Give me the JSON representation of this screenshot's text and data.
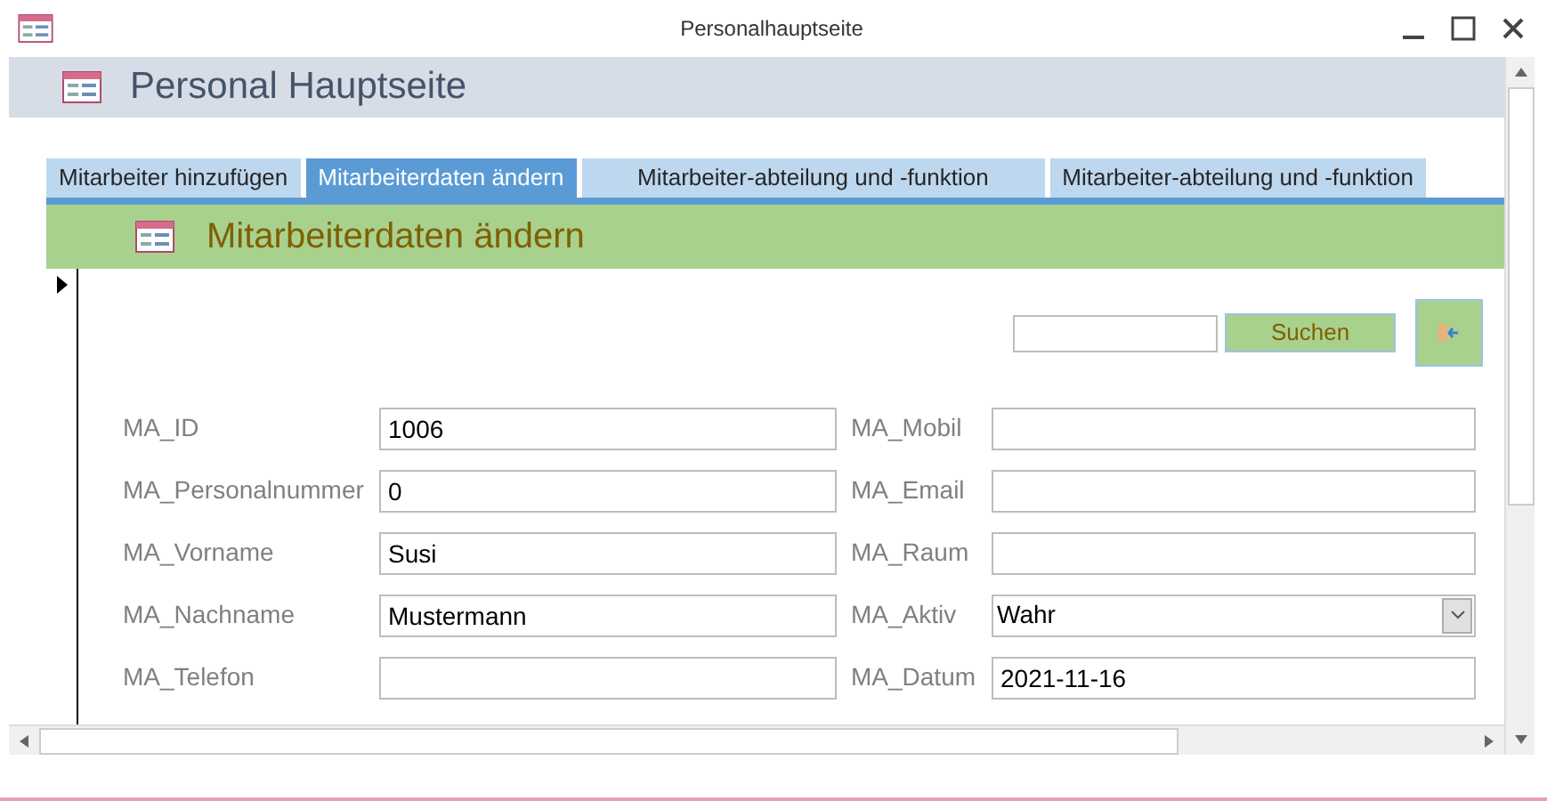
{
  "window": {
    "title": "Personalhauptseite"
  },
  "header": {
    "title": "Personal Hauptseite"
  },
  "tabs": [
    {
      "label": "Mitarbeiter hinzufügen",
      "selected": false
    },
    {
      "label": "Mitarbeiterdaten ändern",
      "selected": true
    },
    {
      "label": "Mitarbeiter-abteilung und -funktion",
      "selected": false
    },
    {
      "label": "Mitarbeiter-abteilung und -funktion",
      "selected": false
    }
  ],
  "section": {
    "title": "Mitarbeiterdaten ändern"
  },
  "search": {
    "button": "Suchen"
  },
  "fields_left": [
    {
      "label": "MA_ID",
      "value": "1006"
    },
    {
      "label": "MA_Personalnummer",
      "value": "0"
    },
    {
      "label": "MA_Vorname",
      "value": "Susi"
    },
    {
      "label": "MA_Nachname",
      "value": "Mustermann"
    },
    {
      "label": "MA_Telefon"
    }
  ],
  "fields_right": [
    {
      "label": "MA_Mobil",
      "kind": "text"
    },
    {
      "label": "MA_Email",
      "kind": "text"
    },
    {
      "label": "MA_Raum",
      "kind": "text"
    },
    {
      "label": "MA_Aktiv",
      "kind": "combo",
      "value": "Wahr"
    },
    {
      "label": "MA_Datum",
      "kind": "text",
      "value": "2021-11-16"
    }
  ]
}
